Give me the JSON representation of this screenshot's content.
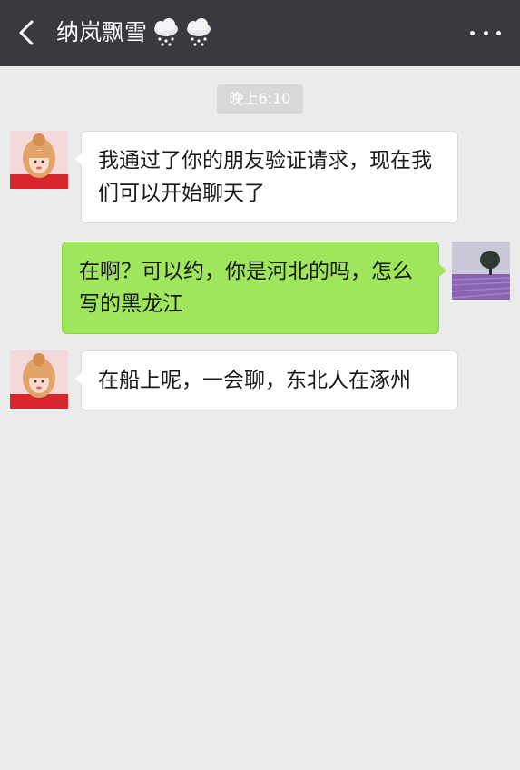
{
  "header": {
    "title": "纳岚飘雪",
    "title_emojis": [
      "snow-cloud-icon",
      "snow-cloud-icon"
    ],
    "back_icon": "chevron-left-icon",
    "more_icon": "more-dots-icon",
    "background": "#393a3f"
  },
  "chat": {
    "background": "#ebebeb",
    "timestamp": "晚上6:10",
    "messages": [
      {
        "sender": "contact",
        "text": "我通过了你的朋友验证请求，现在我们可以开始聊天了"
      },
      {
        "sender": "me",
        "text": "在啊？可以约，你是河北的吗，怎么写的黑龙江"
      },
      {
        "sender": "contact",
        "text": "在船上呢，一会聊，东北人在涿州"
      }
    ]
  },
  "colors": {
    "incoming_bubble": "#ffffff",
    "outgoing_bubble": "#9fe65c",
    "header_text": "#ffffff"
  }
}
